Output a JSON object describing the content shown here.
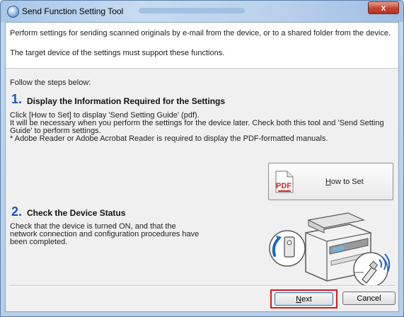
{
  "window": {
    "title": "Send Function Setting Tool",
    "close_glyph": "x"
  },
  "intro": {
    "line1": "Perform settings for sending scanned originals by e-mail from the device, or to a shared folder from the device.",
    "line2": "The target device of the settings must support these functions."
  },
  "follow_text": "Follow the steps below:",
  "step1": {
    "number": "1.",
    "title": "Display the Information Required for the Settings",
    "body_line1": "Click [How to Set] to display 'Send Setting Guide' (pdf).",
    "body_line2": "It will be necessary when you perform the settings for the device later. Check both this tool and 'Send Setting Guide' to perform settings.",
    "body_line3": "* Adobe Reader or Adobe Acrobat Reader is required to display the PDF-formatted manuals."
  },
  "how_to_set": {
    "mnemonic": "H",
    "rest": "ow to Set",
    "icon": "pdf-file-icon",
    "icon_text": "PDF"
  },
  "step2": {
    "number": "2.",
    "title": "Check the Device Status",
    "body": "Check that the device is turned ON, and that the network connection and configuration procedures have been completed."
  },
  "buttons": {
    "next_mnemonic": "N",
    "next_rest": "ext",
    "cancel": "Cancel"
  },
  "colors": {
    "step_number": "#1b54c6",
    "highlight_border": "#e0141a",
    "pdf_red": "#d7261d"
  }
}
